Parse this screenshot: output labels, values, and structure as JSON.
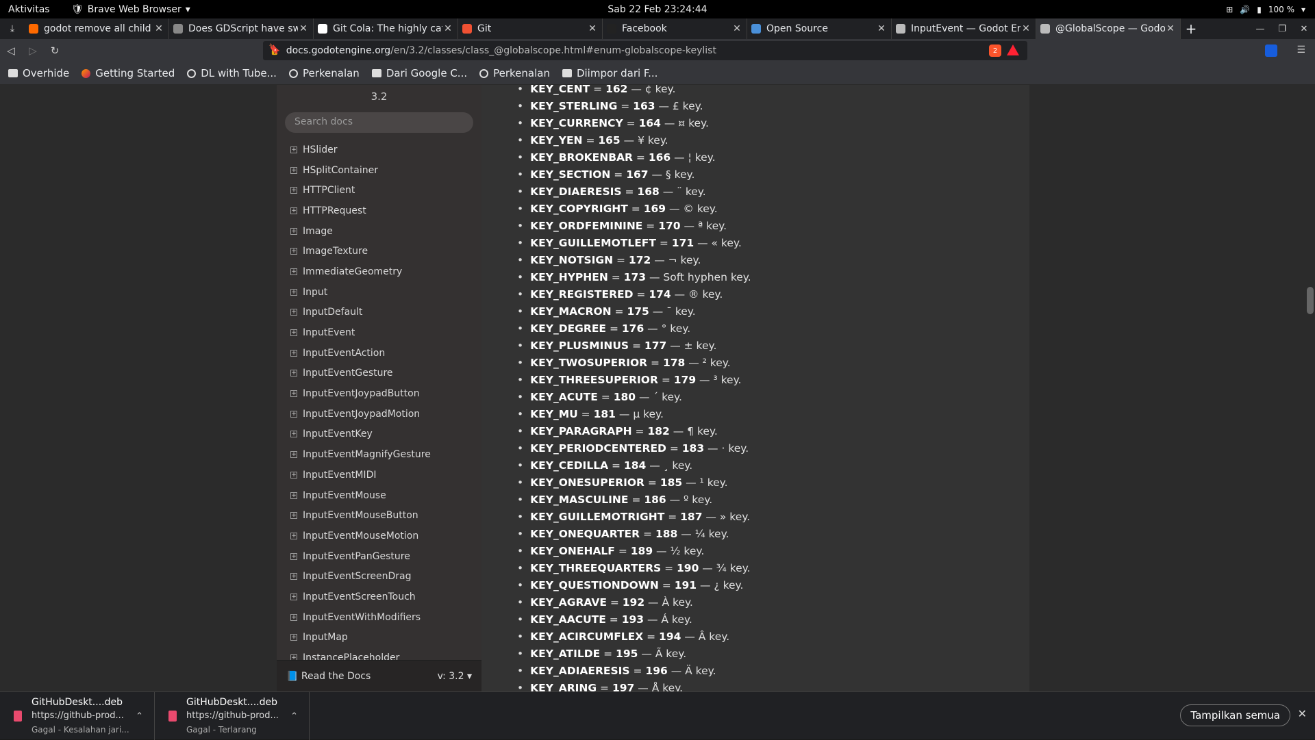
{
  "system": {
    "activities": "Aktivitas",
    "app_name": "Brave Web Browser",
    "clock": "Sab 22 Feb  23:24:44",
    "battery": "100 %"
  },
  "tabs": [
    {
      "title": "godot remove all child",
      "color": "#ff6a00",
      "active": false
    },
    {
      "title": "Does GDScript have sw",
      "color": "#888888",
      "active": false
    },
    {
      "title": "Git Cola: The highly caff",
      "color": "#ffffff",
      "active": false
    },
    {
      "title": "Git",
      "color": "#f05133",
      "active": false
    },
    {
      "title": "Facebook",
      "color": "#222222",
      "active": false
    },
    {
      "title": "Open Source",
      "color": "#4a90d9",
      "active": false
    },
    {
      "title": "InputEvent — Godot En",
      "color": "#bbbbbb",
      "active": false
    },
    {
      "title": "@GlobalScope — Godo",
      "color": "#bbbbbb",
      "active": true
    }
  ],
  "address": {
    "host": "docs.godotengine.org",
    "path": "/en/3.2/classes/class_@globalscope.html#enum-globalscope-keylist",
    "shield_count": "2"
  },
  "bookmarks": [
    {
      "label": "Overhide",
      "icon": "folder"
    },
    {
      "label": "Getting Started",
      "icon": "firefox"
    },
    {
      "label": "DL with Tube...",
      "icon": "globe"
    },
    {
      "label": "Perkenalan",
      "icon": "globe"
    },
    {
      "label": "Dari Google C...",
      "icon": "folder"
    },
    {
      "label": "Perkenalan",
      "icon": "globe"
    },
    {
      "label": "Diimpor dari F...",
      "icon": "folder"
    }
  ],
  "sidebar": {
    "version": "3.2",
    "search_placeholder": "Search docs",
    "items": [
      "HSlider",
      "HSplitContainer",
      "HTTPClient",
      "HTTPRequest",
      "Image",
      "ImageTexture",
      "ImmediateGeometry",
      "Input",
      "InputDefault",
      "InputEvent",
      "InputEventAction",
      "InputEventGesture",
      "InputEventJoypadButton",
      "InputEventJoypadMotion",
      "InputEventKey",
      "InputEventMagnifyGesture",
      "InputEventMIDI",
      "InputEventMouse",
      "InputEventMouseButton",
      "InputEventMouseMotion",
      "InputEventPanGesture",
      "InputEventScreenDrag",
      "InputEventScreenTouch",
      "InputEventWithModifiers",
      "InputMap",
      "InstancePlaceholder"
    ],
    "footer_label": "Read the Docs",
    "footer_version": "v: 3.2"
  },
  "keys": [
    {
      "name": "KEY_CENT",
      "value": "162",
      "desc": "¢ key."
    },
    {
      "name": "KEY_STERLING",
      "value": "163",
      "desc": "£ key."
    },
    {
      "name": "KEY_CURRENCY",
      "value": "164",
      "desc": "¤ key."
    },
    {
      "name": "KEY_YEN",
      "value": "165",
      "desc": "¥ key."
    },
    {
      "name": "KEY_BROKENBAR",
      "value": "166",
      "desc": "¦ key."
    },
    {
      "name": "KEY_SECTION",
      "value": "167",
      "desc": "§ key."
    },
    {
      "name": "KEY_DIAERESIS",
      "value": "168",
      "desc": "¨ key."
    },
    {
      "name": "KEY_COPYRIGHT",
      "value": "169",
      "desc": "© key."
    },
    {
      "name": "KEY_ORDFEMININE",
      "value": "170",
      "desc": "ª key."
    },
    {
      "name": "KEY_GUILLEMOTLEFT",
      "value": "171",
      "desc": "« key."
    },
    {
      "name": "KEY_NOTSIGN",
      "value": "172",
      "desc": "¬ key."
    },
    {
      "name": "KEY_HYPHEN",
      "value": "173",
      "desc": "Soft hyphen key."
    },
    {
      "name": "KEY_REGISTERED",
      "value": "174",
      "desc": "® key."
    },
    {
      "name": "KEY_MACRON",
      "value": "175",
      "desc": "¯ key."
    },
    {
      "name": "KEY_DEGREE",
      "value": "176",
      "desc": "° key."
    },
    {
      "name": "KEY_PLUSMINUS",
      "value": "177",
      "desc": "± key."
    },
    {
      "name": "KEY_TWOSUPERIOR",
      "value": "178",
      "desc": "² key."
    },
    {
      "name": "KEY_THREESUPERIOR",
      "value": "179",
      "desc": "³ key."
    },
    {
      "name": "KEY_ACUTE",
      "value": "180",
      "desc": "´ key."
    },
    {
      "name": "KEY_MU",
      "value": "181",
      "desc": "µ key."
    },
    {
      "name": "KEY_PARAGRAPH",
      "value": "182",
      "desc": "¶ key."
    },
    {
      "name": "KEY_PERIODCENTERED",
      "value": "183",
      "desc": "· key."
    },
    {
      "name": "KEY_CEDILLA",
      "value": "184",
      "desc": "¸ key."
    },
    {
      "name": "KEY_ONESUPERIOR",
      "value": "185",
      "desc": "¹ key."
    },
    {
      "name": "KEY_MASCULINE",
      "value": "186",
      "desc": "º key."
    },
    {
      "name": "KEY_GUILLEMOTRIGHT",
      "value": "187",
      "desc": "» key."
    },
    {
      "name": "KEY_ONEQUARTER",
      "value": "188",
      "desc": "¼ key."
    },
    {
      "name": "KEY_ONEHALF",
      "value": "189",
      "desc": "½ key."
    },
    {
      "name": "KEY_THREEQUARTERS",
      "value": "190",
      "desc": "¾ key."
    },
    {
      "name": "KEY_QUESTIONDOWN",
      "value": "191",
      "desc": "¿ key."
    },
    {
      "name": "KEY_AGRAVE",
      "value": "192",
      "desc": "À key."
    },
    {
      "name": "KEY_AACUTE",
      "value": "193",
      "desc": "Á key."
    },
    {
      "name": "KEY_ACIRCUMFLEX",
      "value": "194",
      "desc": "Â key."
    },
    {
      "name": "KEY_ATILDE",
      "value": "195",
      "desc": "Ã key."
    },
    {
      "name": "KEY_ADIAERESIS",
      "value": "196",
      "desc": "Ä key."
    },
    {
      "name": "KEY_ARING",
      "value": "197",
      "desc": "Å key."
    }
  ],
  "downloads": [
    {
      "name": "GitHubDeskt....deb",
      "url": "https://github-prod...",
      "status": "Gagal - Kesalahan jari..."
    },
    {
      "name": "GitHubDeskt....deb",
      "url": "https://github-prod...",
      "status": "Gagal - Terlarang"
    }
  ],
  "show_all": "Tampilkan semua"
}
